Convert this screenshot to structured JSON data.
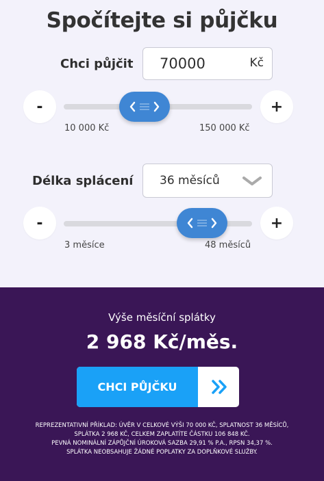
{
  "title": "Spočítejte si půjčku",
  "amount": {
    "label": "Chci půjčit",
    "value": "70000",
    "unit": "Kč",
    "slider": {
      "min_label": "10 000 Kč",
      "max_label": "150 000 Kč",
      "min": 10000,
      "max": 150000,
      "value": 70000,
      "minus": "-",
      "plus": "+"
    }
  },
  "duration": {
    "label": "Délka splácení",
    "selected": "36 měsíců",
    "slider": {
      "min_label": "3 měsíce",
      "max_label": "48 měsíců",
      "min": 3,
      "max": 48,
      "value": 36,
      "minus": "-",
      "plus": "+"
    }
  },
  "result": {
    "label": "Výše měsíční splátky",
    "value": "2 968 Kč/měs."
  },
  "cta": {
    "label": "CHCI PŮJČKU",
    "arrow_icon": "double-chevron-right-icon",
    "color": "#1aa1f7"
  },
  "disclaimer": {
    "line1": "Reprezentativní příklad: Úvěr v celkové výši 70 000 Kč, splatnost 36 měsíců,",
    "line2": "splátka 2 968 Kč, celkem zaplatíte částku 106 848 Kč.",
    "line3": "Pevná nominální zápůjční úroková sazba 29,91 % p.a., RPSN 34,37 %.",
    "line4": "Splátka neobsahuje žádné poplatky za doplňkové služby."
  },
  "colors": {
    "background_top": "#f3f2fb",
    "background_bottom": "#3a1656",
    "slider_thumb": "#3f86d4"
  }
}
